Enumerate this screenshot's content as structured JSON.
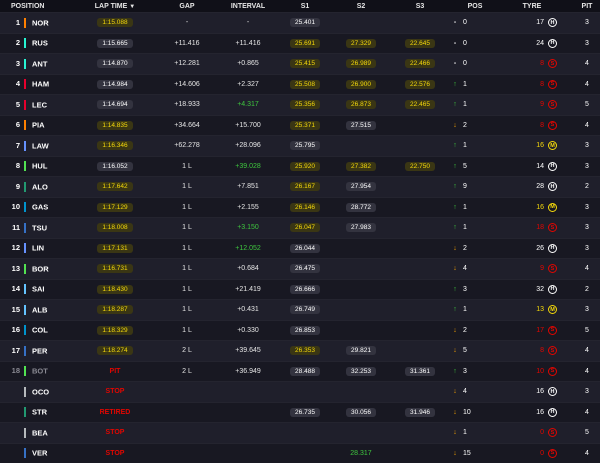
{
  "columns": {
    "position": "POSITION",
    "lap_time": "LAP TIME",
    "gap": "GAP",
    "interval": "INTERVAL",
    "s1": "S1",
    "s2": "S2",
    "s3": "S3",
    "pos": "POS",
    "tyre": "TYRE",
    "pit": "PIT"
  },
  "team_colors": {
    "mclaren": "#ff8000",
    "redbull": "#3671c6",
    "mercedes": "#27f4d2",
    "ferrari": "#e8002d",
    "sauber": "#52e252",
    "astonmartin": "#229971",
    "alpine": "#0093cc",
    "rb": "#6692ff",
    "williams": "#64c4ff",
    "haas": "#b6babd"
  },
  "rows": [
    {
      "num": "1",
      "code": "NOR",
      "team": "mclaren",
      "lap": "1:15.088",
      "lap_style": "yellow",
      "gap": "-",
      "interval": "-",
      "interval_style": "",
      "s1": "25.401",
      "s1_style": "grey",
      "s2": "",
      "s2_style": "",
      "s3": "",
      "s3_style": "",
      "pos_arrow": "-",
      "pos_change": "0",
      "pos_dir": "none",
      "tyre_age": "17",
      "tyre": "H",
      "pit": "3"
    },
    {
      "num": "2",
      "code": "RUS",
      "team": "mercedes",
      "lap": "1:15.665",
      "lap_style": "grey",
      "gap": "+11.416",
      "interval": "+11.416",
      "interval_style": "",
      "s1": "25.691",
      "s1_style": "yellow",
      "s2": "27.329",
      "s2_style": "yellow",
      "s3": "22.645",
      "s3_style": "yellow",
      "pos_arrow": "-",
      "pos_change": "0",
      "pos_dir": "none",
      "tyre_age": "24",
      "tyre": "H",
      "pit": "3"
    },
    {
      "num": "3",
      "code": "ANT",
      "team": "mercedes",
      "lap": "1:14.870",
      "lap_style": "grey",
      "gap": "+12.281",
      "interval": "+0.865",
      "interval_style": "",
      "s1": "25.415",
      "s1_style": "yellow",
      "s2": "26.989",
      "s2_style": "yellow",
      "s3": "22.466",
      "s3_style": "yellow",
      "pos_arrow": "-",
      "pos_change": "0",
      "pos_dir": "none",
      "tyre_age": "8",
      "tyre": "S",
      "pit": "4"
    },
    {
      "num": "4",
      "code": "HAM",
      "team": "ferrari",
      "lap": "1:14.984",
      "lap_style": "grey",
      "gap": "+14.606",
      "interval": "+2.327",
      "interval_style": "",
      "s1": "25.508",
      "s1_style": "yellow",
      "s2": "26.900",
      "s2_style": "yellow",
      "s3": "22.576",
      "s3_style": "yellow",
      "pos_arrow": "↑",
      "pos_change": "1",
      "pos_dir": "up",
      "tyre_age": "8",
      "tyre": "S",
      "pit": "4"
    },
    {
      "num": "5",
      "code": "LEC",
      "team": "ferrari",
      "lap": "1:14.694",
      "lap_style": "grey",
      "gap": "+18.933",
      "interval": "+4.317",
      "interval_style": "green",
      "s1": "25.356",
      "s1_style": "yellow",
      "s2": "26.873",
      "s2_style": "yellow",
      "s3": "22.465",
      "s3_style": "yellow",
      "pos_arrow": "↑",
      "pos_change": "1",
      "pos_dir": "up",
      "tyre_age": "9",
      "tyre": "S",
      "pit": "5"
    },
    {
      "num": "6",
      "code": "PIA",
      "team": "mclaren",
      "lap": "1:14.835",
      "lap_style": "yellow",
      "gap": "+34.664",
      "interval": "+15.700",
      "interval_style": "",
      "s1": "25.371",
      "s1_style": "yellow",
      "s2": "27.515",
      "s2_style": "grey",
      "s3": "",
      "s3_style": "",
      "pos_arrow": "↓",
      "pos_change": "2",
      "pos_dir": "down",
      "tyre_age": "8",
      "tyre": "S",
      "pit": "4"
    },
    {
      "num": "7",
      "code": "LAW",
      "team": "rb",
      "lap": "1:16.346",
      "lap_style": "yellow",
      "gap": "+62.278",
      "interval": "+28.096",
      "interval_style": "",
      "s1": "25.795",
      "s1_style": "grey",
      "s2": "",
      "s2_style": "",
      "s3": "",
      "s3_style": "",
      "pos_arrow": "↑",
      "pos_change": "1",
      "pos_dir": "up",
      "tyre_age": "16",
      "tyre": "M",
      "pit": "3"
    },
    {
      "num": "8",
      "code": "HUL",
      "team": "sauber",
      "lap": "1:16.052",
      "lap_style": "grey",
      "gap": "1 L",
      "interval": "+39.028",
      "interval_style": "green",
      "s1": "25.920",
      "s1_style": "yellow",
      "s2": "27.382",
      "s2_style": "yellow",
      "s3": "22.750",
      "s3_style": "yellow",
      "pos_arrow": "↑",
      "pos_change": "5",
      "pos_dir": "up",
      "tyre_age": "14",
      "tyre": "H",
      "pit": "3"
    },
    {
      "num": "9",
      "code": "ALO",
      "team": "astonmartin",
      "lap": "1:17.642",
      "lap_style": "yellow",
      "gap": "1 L",
      "interval": "+7.851",
      "interval_style": "",
      "s1": "26.167",
      "s1_style": "yellow",
      "s2": "27.954",
      "s2_style": "grey",
      "s3": "",
      "s3_style": "",
      "pos_arrow": "↑",
      "pos_change": "9",
      "pos_dir": "up",
      "tyre_age": "28",
      "tyre": "H",
      "pit": "2"
    },
    {
      "num": "10",
      "code": "GAS",
      "team": "alpine",
      "lap": "1:17.129",
      "lap_style": "yellow",
      "gap": "1 L",
      "interval": "+2.155",
      "interval_style": "",
      "s1": "26.146",
      "s1_style": "yellow",
      "s2": "28.772",
      "s2_style": "grey",
      "s3": "",
      "s3_style": "",
      "pos_arrow": "↑",
      "pos_change": "1",
      "pos_dir": "up",
      "tyre_age": "16",
      "tyre": "M",
      "pit": "3"
    },
    {
      "num": "11",
      "code": "TSU",
      "team": "redbull",
      "lap": "1:18.008",
      "lap_style": "yellow",
      "gap": "1 L",
      "interval": "+3.150",
      "interval_style": "green",
      "s1": "26.047",
      "s1_style": "yellow",
      "s2": "27.983",
      "s2_style": "grey",
      "s3": "",
      "s3_style": "",
      "pos_arrow": "↑",
      "pos_change": "1",
      "pos_dir": "up",
      "tyre_age": "18",
      "tyre": "S",
      "pit": "3"
    },
    {
      "num": "12",
      "code": "LIN",
      "team": "rb",
      "lap": "1:17.131",
      "lap_style": "yellow",
      "gap": "1 L",
      "interval": "+12.052",
      "interval_style": "green",
      "s1": "26.044",
      "s1_style": "grey",
      "s2": "",
      "s2_style": "",
      "s3": "",
      "s3_style": "",
      "pos_arrow": "↓",
      "pos_change": "2",
      "pos_dir": "down",
      "tyre_age": "26",
      "tyre": "H",
      "pit": "3"
    },
    {
      "num": "13",
      "code": "BOR",
      "team": "sauber",
      "lap": "1:16.731",
      "lap_style": "yellow",
      "gap": "1 L",
      "interval": "+0.684",
      "interval_style": "",
      "s1": "26.475",
      "s1_style": "grey",
      "s2": "",
      "s2_style": "",
      "s3": "",
      "s3_style": "",
      "pos_arrow": "↓",
      "pos_change": "4",
      "pos_dir": "down",
      "tyre_age": "9",
      "tyre": "S",
      "pit": "4"
    },
    {
      "num": "14",
      "code": "SAI",
      "team": "williams",
      "lap": "1:18.430",
      "lap_style": "yellow",
      "gap": "1 L",
      "interval": "+21.419",
      "interval_style": "",
      "s1": "26.666",
      "s1_style": "grey",
      "s2": "",
      "s2_style": "",
      "s3": "",
      "s3_style": "",
      "pos_arrow": "↑",
      "pos_change": "3",
      "pos_dir": "up",
      "tyre_age": "32",
      "tyre": "H",
      "pit": "2"
    },
    {
      "num": "15",
      "code": "ALB",
      "team": "williams",
      "lap": "1:18.287",
      "lap_style": "yellow",
      "gap": "1 L",
      "interval": "+0.431",
      "interval_style": "",
      "s1": "26.749",
      "s1_style": "grey",
      "s2": "",
      "s2_style": "",
      "s3": "",
      "s3_style": "",
      "pos_arrow": "↑",
      "pos_change": "1",
      "pos_dir": "up",
      "tyre_age": "13",
      "tyre": "M",
      "pit": "3"
    },
    {
      "num": "16",
      "code": "COL",
      "team": "alpine",
      "lap": "1:18.329",
      "lap_style": "yellow",
      "gap": "1 L",
      "interval": "+0.330",
      "interval_style": "",
      "s1": "26.853",
      "s1_style": "grey",
      "s2": "",
      "s2_style": "",
      "s3": "",
      "s3_style": "",
      "pos_arrow": "↓",
      "pos_change": "2",
      "pos_dir": "down",
      "tyre_age": "17",
      "tyre": "S",
      "pit": "5"
    },
    {
      "num": "17",
      "code": "PER",
      "team": "redbull",
      "lap": "1:18.274",
      "lap_style": "yellow",
      "gap": "2 L",
      "interval": "+39.645",
      "interval_style": "",
      "s1": "26.353",
      "s1_style": "yellow",
      "s2": "29.821",
      "s2_style": "grey",
      "s3": "",
      "s3_style": "",
      "pos_arrow": "↓",
      "pos_change": "5",
      "pos_dir": "down",
      "tyre_age": "8",
      "tyre": "S",
      "pit": "4"
    },
    {
      "num": "18",
      "code": "BOT",
      "team": "sauber",
      "lap": "PIT",
      "lap_style": "red",
      "gap": "2 L",
      "interval": "+36.949",
      "interval_style": "",
      "s1": "28.488",
      "s1_style": "grey",
      "s2": "32.253",
      "s2_style": "grey",
      "s3": "31.361",
      "s3_style": "grey",
      "pos_arrow": "↑",
      "pos_change": "3",
      "pos_dir": "up",
      "tyre_age": "10",
      "tyre": "S",
      "pit": "4",
      "dim": true
    },
    {
      "num": "",
      "code": "OCO",
      "team": "haas",
      "lap": "STOP",
      "lap_style": "red",
      "gap": "",
      "interval": "",
      "interval_style": "",
      "s1": "",
      "s1_style": "",
      "s2": "",
      "s2_style": "",
      "s3": "",
      "s3_style": "",
      "pos_arrow": "↓",
      "pos_change": "4",
      "pos_dir": "down",
      "tyre_age": "16",
      "tyre": "H",
      "pit": "3"
    },
    {
      "num": "",
      "code": "STR",
      "team": "astonmartin",
      "lap": "RETIRED",
      "lap_style": "red",
      "gap": "",
      "interval": "",
      "interval_style": "",
      "s1": "26.735",
      "s1_style": "grey",
      "s2": "30.056",
      "s2_style": "grey",
      "s3": "31.946",
      "s3_style": "grey",
      "pos_arrow": "↓",
      "pos_change": "10",
      "pos_dir": "down",
      "tyre_age": "16",
      "tyre": "H",
      "pit": "4"
    },
    {
      "num": "",
      "code": "BEA",
      "team": "haas",
      "lap": "STOP",
      "lap_style": "red",
      "gap": "",
      "interval": "",
      "interval_style": "",
      "s1": "",
      "s1_style": "",
      "s2": "",
      "s2_style": "",
      "s3": "",
      "s3_style": "",
      "pos_arrow": "↓",
      "pos_change": "1",
      "pos_dir": "down",
      "tyre_age": "0",
      "tyre": "S",
      "pit": "5"
    },
    {
      "num": "",
      "code": "VER",
      "team": "redbull",
      "lap": "STOP",
      "lap_style": "red",
      "gap": "",
      "interval": "",
      "interval_style": "",
      "s1": "",
      "s1_style": "",
      "s2": "28.317",
      "s2_style": "green",
      "s3": "",
      "s3_style": "",
      "pos_arrow": "↓",
      "pos_change": "15",
      "pos_dir": "down",
      "tyre_age": "0",
      "tyre": "S",
      "pit": "4"
    }
  ]
}
